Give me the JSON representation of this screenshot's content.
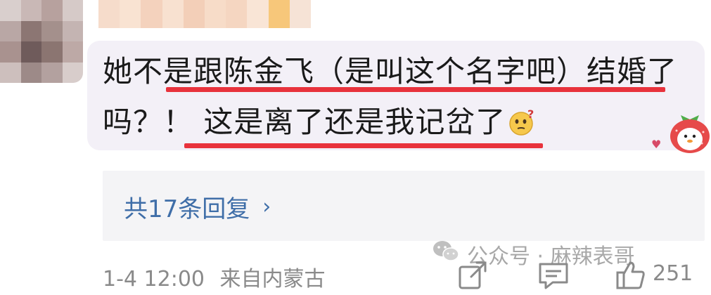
{
  "comment": {
    "line1": "她不是跟陈金飞（是叫这个名字吧）结婚了",
    "line2": "吗？！ 这是离了还是我记岔了",
    "emoji": "thinking-face-icon"
  },
  "replies": {
    "label": "共17条回复",
    "chevron": "›"
  },
  "meta": {
    "time": "1-4 12:00",
    "location": "来自内蒙古"
  },
  "watermark": {
    "text": "公众号 · 麻辣表哥",
    "icon": "wechat-icon"
  },
  "actions": {
    "like_count": "251",
    "share_icon": "share-icon",
    "reply_icon": "comment-icon",
    "like_icon": "thumbs-up-icon"
  },
  "colors": {
    "underline": "#e8323c",
    "link": "#3f6ea8",
    "bubble": "#f3f0f7",
    "reply_box": "#f4f4f6",
    "meta": "#8a8a8a"
  }
}
